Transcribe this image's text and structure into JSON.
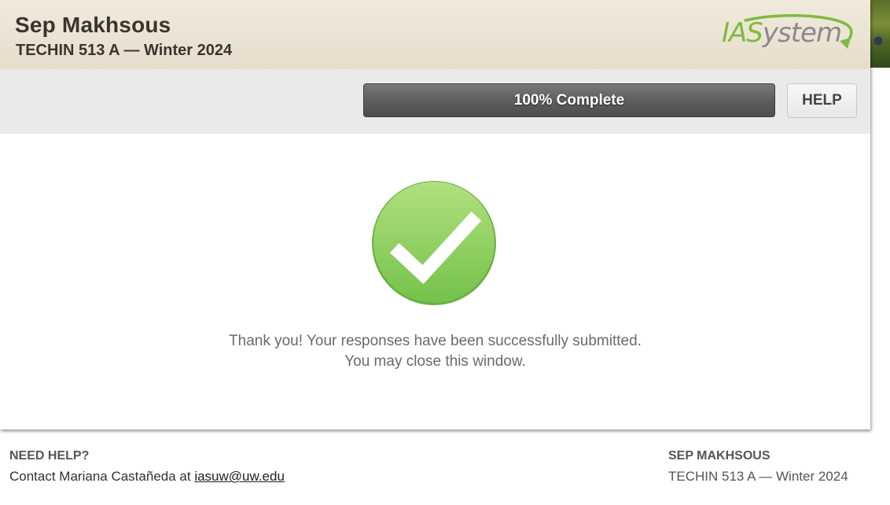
{
  "header": {
    "person_name": "Sep Makhsous",
    "course": "TECHIN 513 A — Winter 2024",
    "logo": {
      "part1": "IAS",
      "part2": "ystem",
      "icon": "swoosh-arrow-icon"
    }
  },
  "toolbar": {
    "progress_label": "100% Complete",
    "progress_fraction": 1.0,
    "help_label": "HELP"
  },
  "main": {
    "status_icon": "checkmark-circle-icon",
    "status_color": "#7dc855",
    "message_line1": "Thank you! Your responses have been successfully submitted.",
    "message_line2": "You may close this window."
  },
  "footer": {
    "help_title": "NEED HELP?",
    "contact_prefix": "Contact Mariana Castañeda at ",
    "contact_email": "iasuw@uw.edu",
    "right_name": "SEP MAKHSOUS",
    "right_course": "TECHIN 513 A — Winter 2024"
  },
  "colors": {
    "header_bg": "#ebe3d3",
    "progress_bg": "#5e5e5e",
    "logo_green": "#7dbb3e",
    "logo_gray": "#8a8a8a"
  }
}
